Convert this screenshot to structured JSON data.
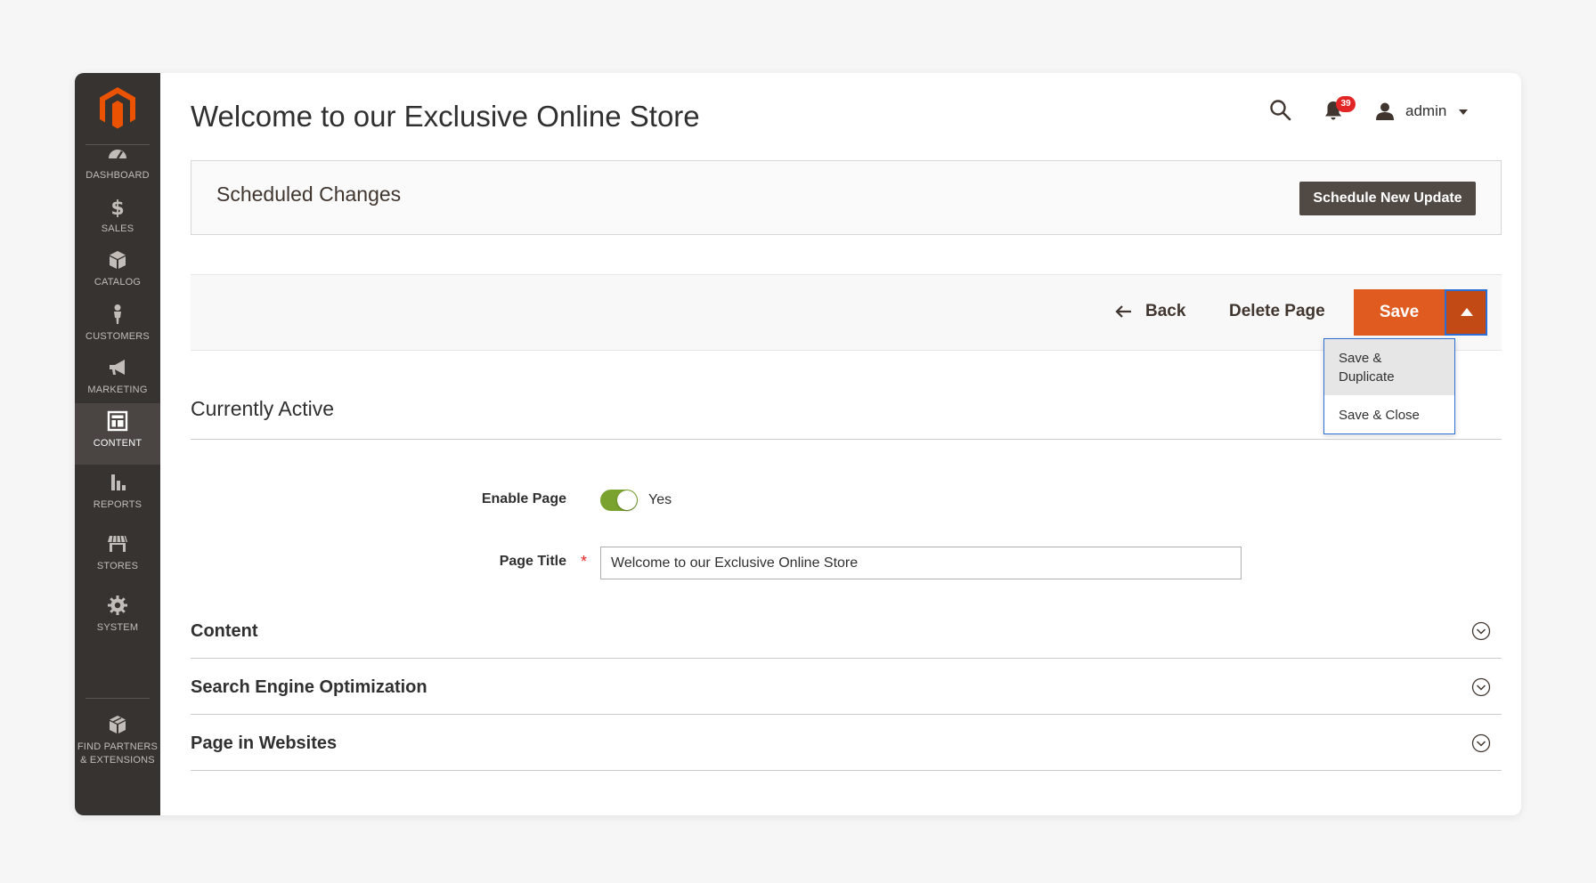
{
  "sidebar": {
    "items": [
      {
        "label": "DASHBOARD",
        "icon": "dashboard-icon"
      },
      {
        "label": "SALES",
        "icon": "dollar-icon"
      },
      {
        "label": "CATALOG",
        "icon": "box-icon"
      },
      {
        "label": "CUSTOMERS",
        "icon": "person-icon"
      },
      {
        "label": "MARKETING",
        "icon": "megaphone-icon"
      },
      {
        "label": "CONTENT",
        "icon": "layout-icon",
        "active": true
      },
      {
        "label": "REPORTS",
        "icon": "bar-chart-icon"
      },
      {
        "label": "STORES",
        "icon": "storefront-icon"
      },
      {
        "label": "SYSTEM",
        "icon": "gear-icon"
      },
      {
        "label_line1": "FIND PARTNERS",
        "label_line2": "& EXTENSIONS",
        "icon": "extensions-icon"
      }
    ]
  },
  "header": {
    "title": "Welcome to our Exclusive Online Store",
    "notifications_count": "39",
    "user": "admin"
  },
  "scheduled": {
    "title": "Scheduled Changes",
    "button": "Schedule New Update"
  },
  "actions": {
    "back": "Back",
    "delete": "Delete Page",
    "save": "Save",
    "dropdown": [
      "Save & Duplicate",
      "Save & Close"
    ]
  },
  "form": {
    "section": "Currently Active",
    "enable_label": "Enable Page",
    "enable_value": "Yes",
    "title_label": "Page Title",
    "title_value": "Welcome to our Exclusive Online Store"
  },
  "collapsibles": [
    "Content",
    "Search Engine Optimization",
    "Page in Websites"
  ],
  "colors": {
    "sidebar": "#373330",
    "accent": "#e05b1f",
    "toggle_on": "#79a22e",
    "badge": "#e22626"
  }
}
